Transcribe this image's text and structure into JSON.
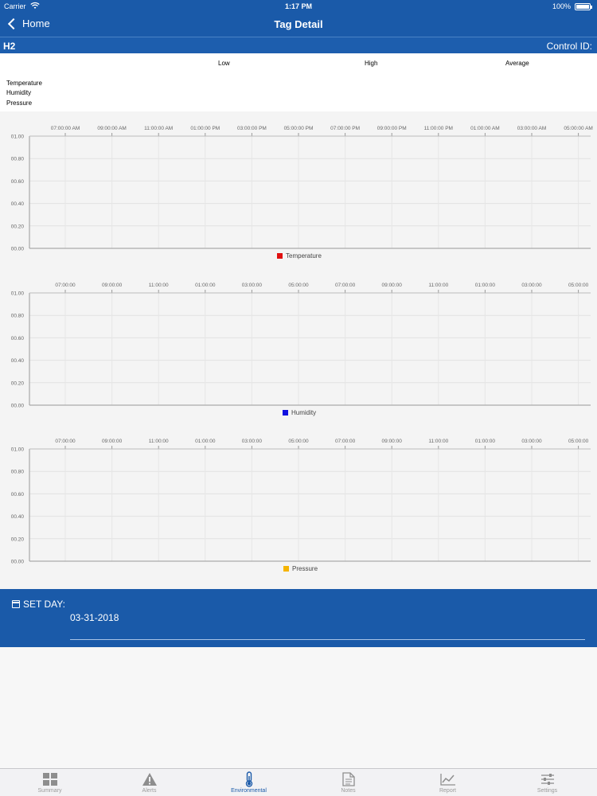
{
  "status": {
    "carrier": "Carrier",
    "time": "1:17 PM",
    "battery": "100%"
  },
  "nav": {
    "back_label": "Home",
    "title": "Tag Detail"
  },
  "subheader": {
    "tag": "H2",
    "control_id": "Control ID:"
  },
  "summary": {
    "columns": [
      "Low",
      "High",
      "Average"
    ],
    "rows": [
      "Temperature",
      "Humidity",
      "Pressure"
    ]
  },
  "chart_data": [
    {
      "type": "line",
      "x": [
        "07:00:00 AM",
        "09:00:00 AM",
        "11:00:00 AM",
        "01:00:00 PM",
        "03:00:00 PM",
        "05:00:00 PM",
        "07:00:00 PM",
        "09:00:00 PM",
        "11:00:00 PM",
        "01:00:00 AM",
        "03:00:00 AM",
        "05:00:00 AM"
      ],
      "y_ticks": [
        "00.00",
        "00.20",
        "00.40",
        "00.60",
        "00.80",
        "01.00"
      ],
      "ylim": [
        0,
        1
      ],
      "series": [
        {
          "name": "Temperature",
          "values": [],
          "color": "#e01010"
        }
      ],
      "grid": true,
      "legend": "bottom-center"
    },
    {
      "type": "line",
      "x": [
        "07:00:00",
        "09:00:00",
        "11:00:00",
        "01:00:00",
        "03:00:00",
        "05:00:00",
        "07:00:00",
        "09:00:00",
        "11:00:00",
        "01:00:00",
        "03:00:00",
        "05:00:00"
      ],
      "y_ticks": [
        "00.00",
        "00.20",
        "00.40",
        "00.60",
        "00.80",
        "01.00"
      ],
      "ylim": [
        0,
        1
      ],
      "series": [
        {
          "name": "Humidity",
          "values": [],
          "color": "#1010e0"
        }
      ],
      "grid": true,
      "legend": "bottom-center"
    },
    {
      "type": "line",
      "x": [
        "07:00:00",
        "09:00:00",
        "11:00:00",
        "01:00:00",
        "03:00:00",
        "05:00:00",
        "07:00:00",
        "09:00:00",
        "11:00:00",
        "01:00:00",
        "03:00:00",
        "05:00:00"
      ],
      "y_ticks": [
        "00.00",
        "00.20",
        "00.40",
        "00.60",
        "00.80",
        "01.00"
      ],
      "ylim": [
        0,
        1
      ],
      "series": [
        {
          "name": "Pressure",
          "values": [],
          "color": "#f5b400"
        }
      ],
      "grid": true,
      "legend": "bottom-center"
    }
  ],
  "set_day": {
    "label": "SET DAY:",
    "value": "03-31-2018"
  },
  "tabs": [
    {
      "label": "Summary",
      "icon": "grid-icon"
    },
    {
      "label": "Alerts",
      "icon": "warning-icon"
    },
    {
      "label": "Environmental",
      "icon": "thermometer-icon",
      "active": true
    },
    {
      "label": "Notes",
      "icon": "document-icon"
    },
    {
      "label": "Report",
      "icon": "line-chart-icon"
    },
    {
      "label": "Settings",
      "icon": "sliders-icon"
    }
  ],
  "colors": {
    "primary": "#1a5aa9",
    "active_tab": "#1a5aa9"
  }
}
